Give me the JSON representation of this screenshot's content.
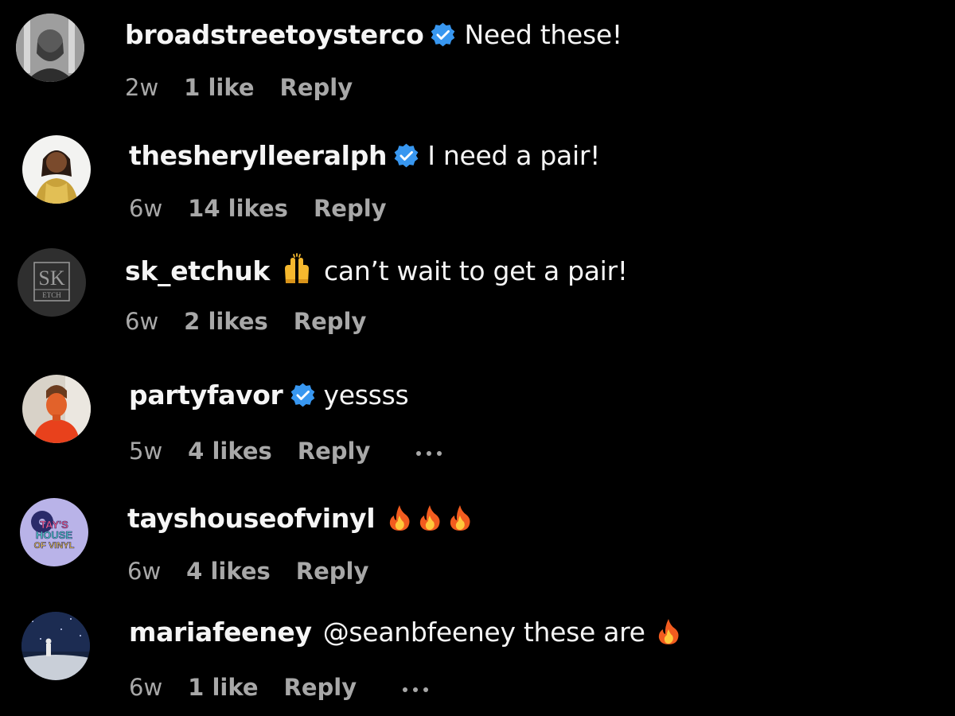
{
  "colors": {
    "background": "#000000",
    "primary_text": "#f5f5f5",
    "secondary_text": "#a8a8a8",
    "verified_badge": "#3897f0"
  },
  "comments": [
    {
      "username": "broadstreetoysterco",
      "verified": true,
      "text": "Need these!",
      "time": "2w",
      "likes": "1 like",
      "reply": "Reply",
      "avatar_icon": "avatar-photo-icon"
    },
    {
      "username": "thesherylleeralph",
      "verified": true,
      "text": "I need a pair!",
      "time": "6w",
      "likes": "14 likes",
      "reply": "Reply",
      "avatar_icon": "avatar-photo-icon"
    },
    {
      "username": "sk_etchuk",
      "verified": false,
      "emoji_before_text": "raising-hands-emoji",
      "text": "can’t wait to get a pair!",
      "time": "6w",
      "likes": "2 likes",
      "reply": "Reply",
      "avatar_logo_text": [
        "SK",
        "ETCH"
      ]
    },
    {
      "username": "partyfavor",
      "verified": true,
      "text": "yessss",
      "time": "5w",
      "likes": "4 likes",
      "reply": "Reply",
      "more_options": true,
      "avatar_icon": "avatar-photo-icon"
    },
    {
      "username": "tayshouseofvinyl",
      "verified": false,
      "text": "",
      "emojis": [
        "fire-emoji",
        "fire-emoji",
        "fire-emoji"
      ],
      "time": "6w",
      "likes": "4 likes",
      "reply": "Reply",
      "avatar_logo_text": [
        "TAY'S",
        "HOUSE",
        "OF VINYL"
      ]
    },
    {
      "username": "mariafeeney",
      "verified": false,
      "text": "@seanbfeeney these are",
      "emojis": [
        "fire-emoji"
      ],
      "time": "6w",
      "likes": "1 like",
      "reply": "Reply",
      "more_options": true,
      "avatar_icon": "avatar-photo-icon"
    }
  ]
}
